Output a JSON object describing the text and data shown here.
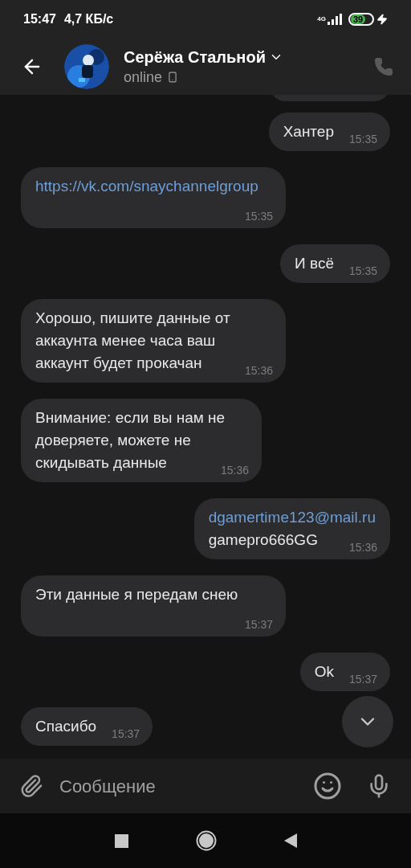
{
  "status_bar": {
    "time": "15:47",
    "speed": "4,7 КБ/с",
    "network": "4G",
    "battery": "39"
  },
  "header": {
    "name": "Серёжа Стальной",
    "status": "online"
  },
  "messages": [
    {
      "kind": "outgoing",
      "parts": [
        {
          "kind": "text",
          "text": "Хантер"
        }
      ],
      "time": "15:35"
    },
    {
      "kind": "incoming",
      "parts": [
        {
          "kind": "link",
          "text": "https://vk.com/snaychannelgroup"
        }
      ],
      "time": "15:35"
    },
    {
      "kind": "outgoing",
      "parts": [
        {
          "kind": "text",
          "text": "И всё"
        }
      ],
      "time": "15:35"
    },
    {
      "kind": "incoming",
      "parts": [
        {
          "kind": "text",
          "text": "Хорошо, пишите данные от аккаунта менее часа ваш аккаунт будет прокачан"
        }
      ],
      "time": "15:36"
    },
    {
      "kind": "incoming",
      "parts": [
        {
          "kind": "text",
          "text": "Внимание: если вы нам не доверяете, можете не скидывать данные"
        }
      ],
      "time": "15:36"
    },
    {
      "kind": "outgoing",
      "parts": [
        {
          "kind": "link",
          "text": "dgamertime123@mail.ru"
        },
        {
          "kind": "text",
          "text": "gamepro666GG"
        }
      ],
      "time": "15:36"
    },
    {
      "kind": "incoming",
      "parts": [
        {
          "kind": "text",
          "text": "Эти данные я передам снею"
        }
      ],
      "time": "15:37"
    },
    {
      "kind": "outgoing",
      "parts": [
        {
          "kind": "text",
          "text": "Ok"
        }
      ],
      "time": "15:37"
    },
    {
      "kind": "incoming",
      "parts": [
        {
          "kind": "text",
          "text": "Спасибо"
        }
      ],
      "time": "15:37"
    }
  ],
  "composer": {
    "placeholder": "Сообщение"
  }
}
